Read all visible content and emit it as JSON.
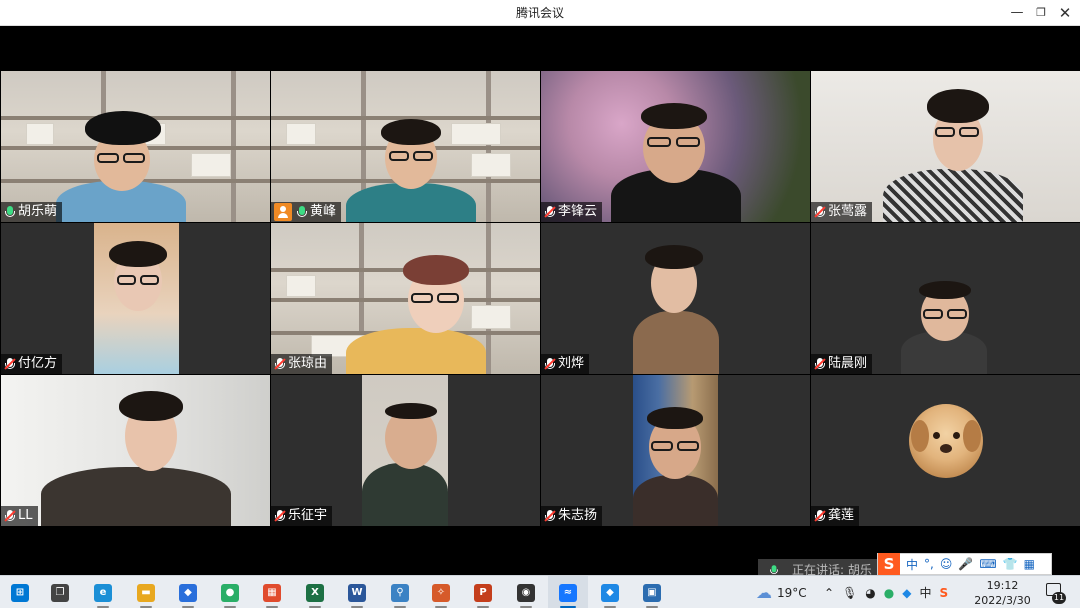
{
  "window": {
    "title": "腾讯会议",
    "min_glyph": "—",
    "max_glyph": "❐",
    "close_glyph": "✕"
  },
  "participants": [
    {
      "name": "胡乐萌",
      "mic": "on",
      "speaking": true
    },
    {
      "name": "黄峰",
      "mic": "on",
      "host": true
    },
    {
      "name": "李锋云",
      "mic": "muted"
    },
    {
      "name": "张莺露",
      "mic": "muted"
    },
    {
      "name": "付亿方",
      "mic": "muted"
    },
    {
      "name": "张琼由",
      "mic": "muted"
    },
    {
      "name": "刘烨",
      "mic": "muted"
    },
    {
      "name": "陆晨刚",
      "mic": "muted"
    },
    {
      "name": "LL",
      "mic": "muted"
    },
    {
      "name": "乐征宇",
      "mic": "muted"
    },
    {
      "name": "朱志扬",
      "mic": "muted"
    },
    {
      "name": "龚莲",
      "mic": "muted",
      "avatar": "dog-photo"
    }
  ],
  "speaking_toast": {
    "text": "正在讲话: 胡乐萌"
  },
  "ime": {
    "logo": "S",
    "mode": "中",
    "punct": "°,",
    "icons": [
      "☺",
      "🎤",
      "⌨",
      "👕",
      "▦"
    ]
  },
  "taskbar": {
    "apps": [
      {
        "name": "start",
        "glyph": "⊞",
        "color": "#0078d4"
      },
      {
        "name": "task-view",
        "glyph": "❐",
        "color": "#444"
      },
      {
        "name": "edge",
        "glyph": "e",
        "color": "#1b8fd6"
      },
      {
        "name": "file-explorer",
        "glyph": "▬",
        "color": "#e8a820"
      },
      {
        "name": "app-cube",
        "glyph": "◆",
        "color": "#2a6fdb"
      },
      {
        "name": "wechat",
        "glyph": "●",
        "color": "#2aae67"
      },
      {
        "name": "store",
        "glyph": "▦",
        "color": "#e04b2d"
      },
      {
        "name": "excel",
        "glyph": "X",
        "color": "#1d7044"
      },
      {
        "name": "word",
        "glyph": "W",
        "color": "#2b579a"
      },
      {
        "name": "app-link",
        "glyph": "⚲",
        "color": "#3b82c4"
      },
      {
        "name": "app-figure",
        "glyph": "✧",
        "color": "#d65a2a"
      },
      {
        "name": "powerpoint",
        "glyph": "P",
        "color": "#c43e1c"
      },
      {
        "name": "app-dark",
        "glyph": "◉",
        "color": "#333"
      },
      {
        "name": "tencent-meeting",
        "glyph": "≈",
        "color": "#1677ff"
      },
      {
        "name": "app-cube-2",
        "glyph": "◆",
        "color": "#1e88e5"
      },
      {
        "name": "photos",
        "glyph": "▣",
        "color": "#2b6cb0"
      }
    ],
    "weather": {
      "temp": "19°C"
    },
    "tray_lang": "中",
    "clock": {
      "time": "19:12",
      "date": "2022/3/30"
    },
    "notifications": "11"
  }
}
